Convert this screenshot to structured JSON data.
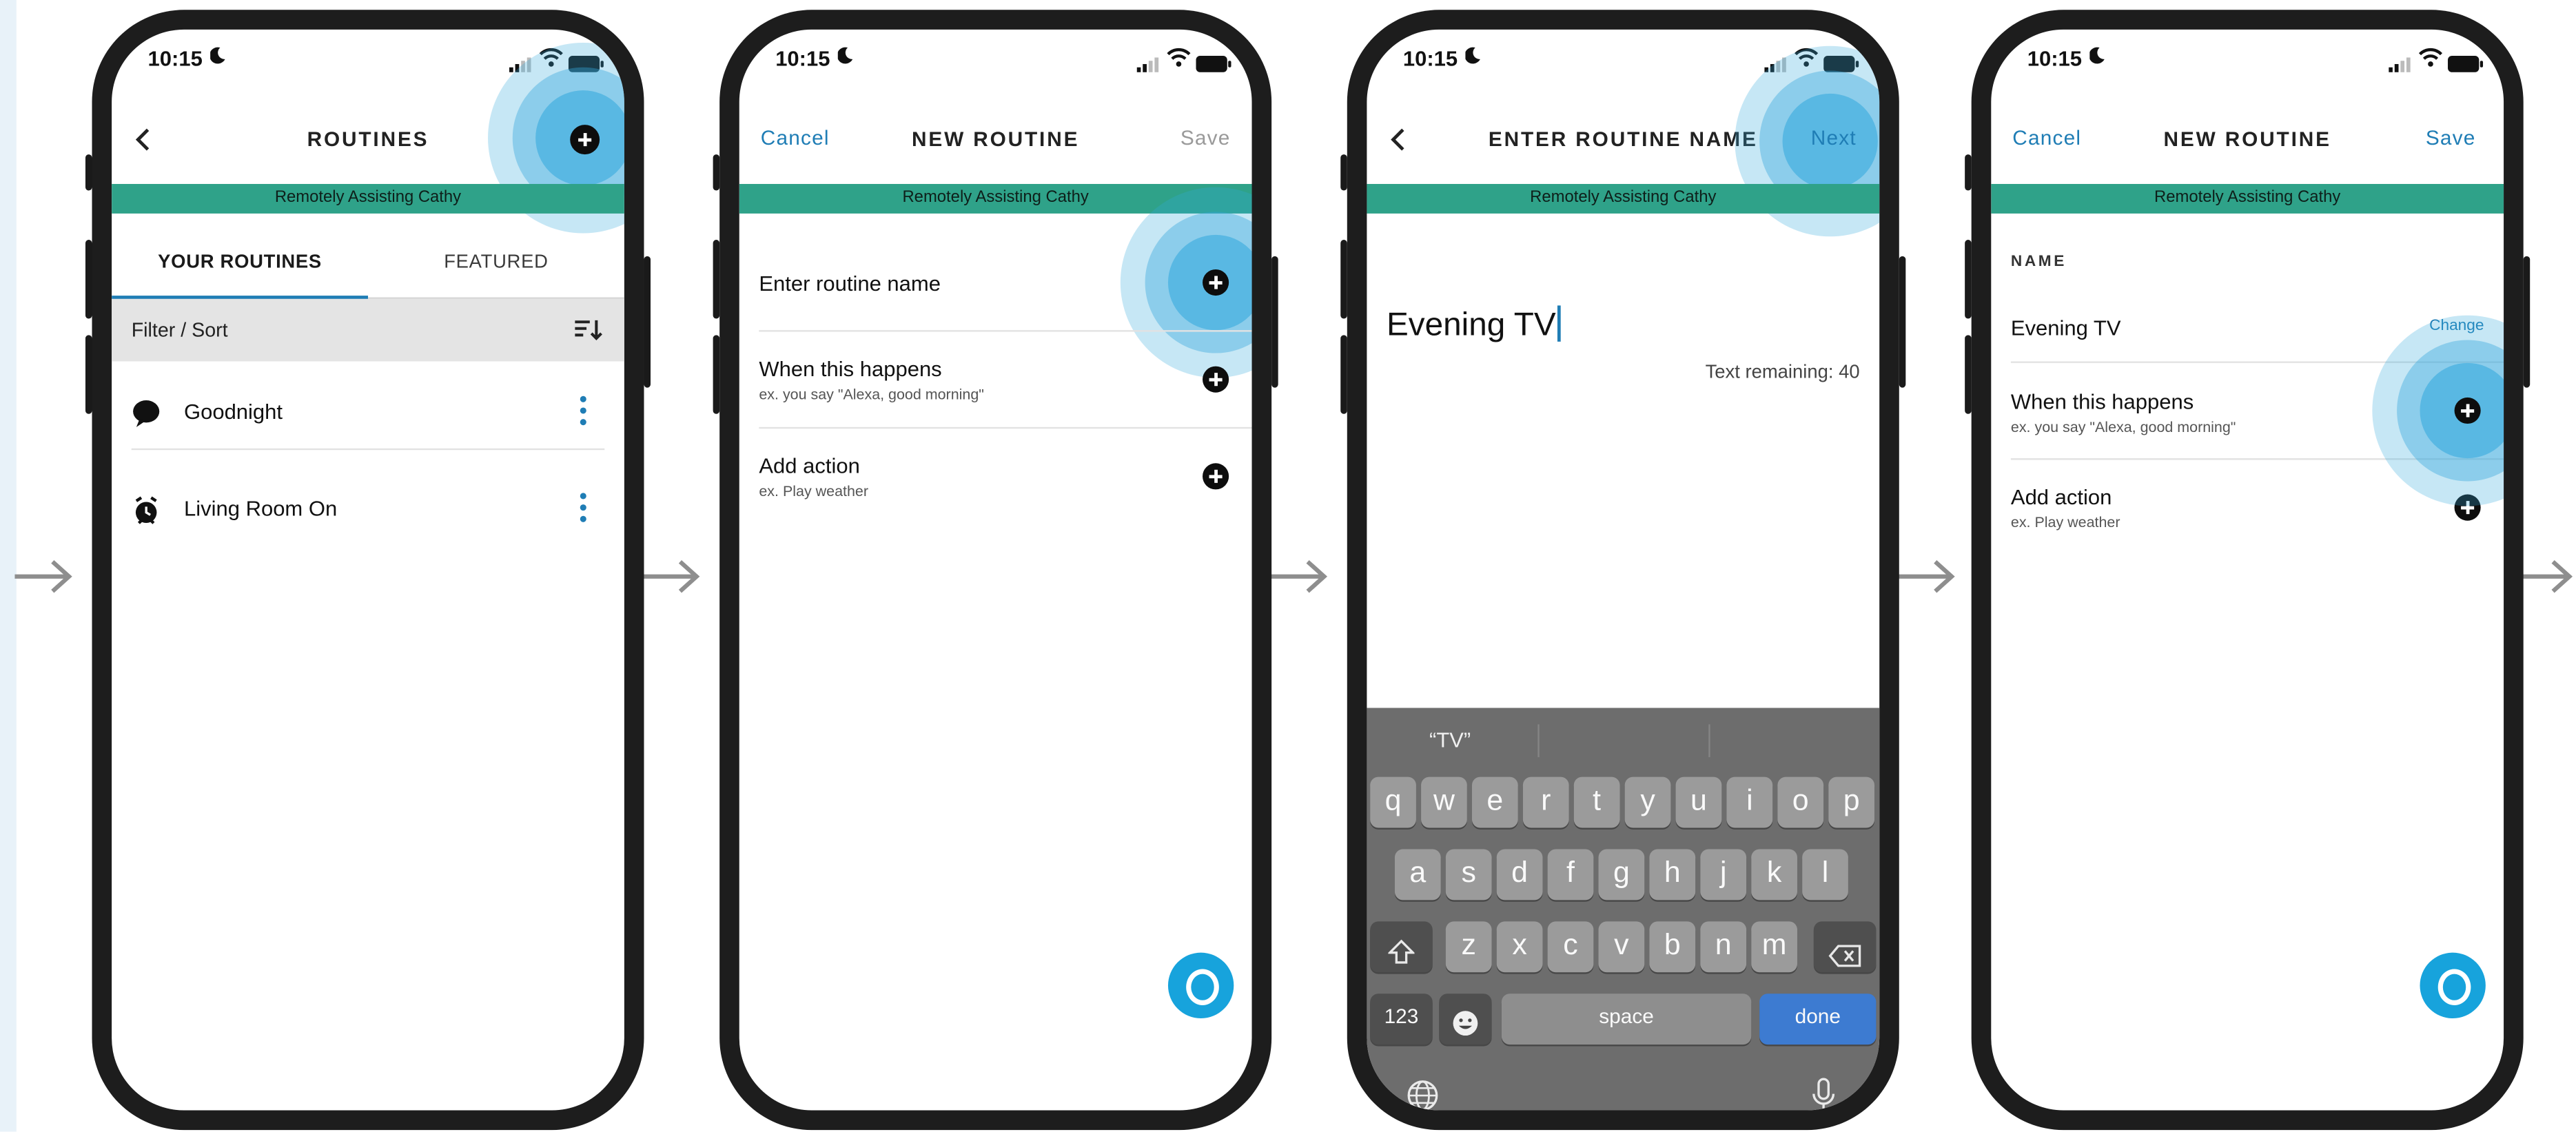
{
  "colors": {
    "accent": "#1f7db5",
    "assist_banner": "#2fa289",
    "alexa_blue": "#17a3dc",
    "highlight": "#34a8dc",
    "phone_frame": "#1d1d1d",
    "keyboard_bg": "#6d6d6d",
    "done_key": "#3d7bd1"
  },
  "status_bar": {
    "time": "10:15",
    "moon_icon": "moon-icon"
  },
  "assist_banner_text": "Remotely Assisting Cathy",
  "screen1": {
    "title": "ROUTINES",
    "tabs": [
      {
        "label": "YOUR ROUTINES",
        "selected": true
      },
      {
        "label": "FEATURED",
        "selected": false
      }
    ],
    "filter_label": "Filter / Sort",
    "routines": [
      {
        "label": "Goodnight",
        "icon": "speech-bubble-icon"
      },
      {
        "label": "Living Room On",
        "icon": "alarm-clock-icon"
      }
    ]
  },
  "screen2": {
    "cancel": "Cancel",
    "title": "NEW ROUTINE",
    "save": "Save",
    "rows": [
      {
        "main": "Enter routine name",
        "sub": ""
      },
      {
        "main": "When this happens",
        "sub": "ex. you say \"Alexa, good morning\""
      },
      {
        "main": "Add action",
        "sub": "ex. Play weather"
      }
    ]
  },
  "screen3": {
    "title": "ENTER ROUTINE NAME",
    "next": "Next",
    "input_value": "Evening TV",
    "remaining": "Text remaining: 40",
    "keyboard": {
      "suggestions": [
        "“TV”",
        "",
        ""
      ],
      "row1": [
        "q",
        "w",
        "e",
        "r",
        "t",
        "y",
        "u",
        "i",
        "o",
        "p"
      ],
      "row2": [
        "a",
        "s",
        "d",
        "f",
        "g",
        "h",
        "j",
        "k",
        "l"
      ],
      "row3": [
        "z",
        "x",
        "c",
        "v",
        "b",
        "n",
        "m"
      ],
      "numbers_key": "123",
      "space_key": "space",
      "done_key": "done"
    }
  },
  "screen4": {
    "cancel": "Cancel",
    "title": "NEW ROUTINE",
    "save": "Save",
    "name_heading": "NAME",
    "name_value": "Evening TV",
    "change": "Change",
    "rows": [
      {
        "main": "When this happens",
        "sub": "ex. you say \"Alexa, good morning\""
      },
      {
        "main": "Add action",
        "sub": "ex. Play weather"
      }
    ]
  }
}
